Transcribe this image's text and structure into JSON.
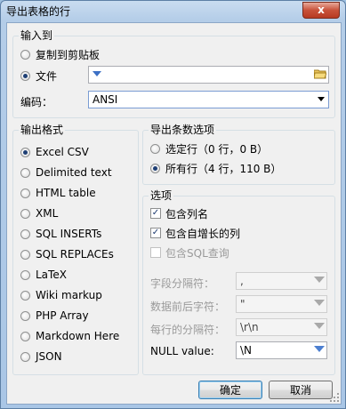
{
  "window": {
    "title": "导出表格的行",
    "close_label": "x"
  },
  "output_to": {
    "legend": "输入到",
    "clipboard_label": "复制到剪贴板",
    "file_label": "文件",
    "file_value": "",
    "encoding_label": "编码：",
    "encoding_value": "ANSI"
  },
  "format": {
    "legend": "输出格式",
    "options": [
      "Excel CSV",
      "Delimited text",
      "HTML table",
      "XML",
      "SQL INSERTs",
      "SQL REPLACEs",
      "LaTeX",
      "Wiki markup",
      "PHP Array",
      "Markdown Here",
      "JSON"
    ],
    "selected": "Excel CSV"
  },
  "row_selection": {
    "legend": "导出条数选项",
    "selected_rows": "选定行（0 行，0 B）",
    "all_rows": "所有行（4 行，110 B）",
    "selected": "all_rows"
  },
  "options": {
    "legend": "选项",
    "include_column_names": "包含列名",
    "include_auto_increment": "包含自增长的列",
    "include_sql_query": "包含SQL查询",
    "field_sep_label": "字段分隔符：",
    "field_sep_value": ",",
    "enclosure_label": "数据前后字符：",
    "enclosure_value": "\"",
    "line_sep_label": "每行的分隔符：",
    "line_sep_value": "\\r\\n",
    "null_label": "NULL value:",
    "null_value": "\\N"
  },
  "buttons": {
    "ok": "确定",
    "cancel": "取消"
  }
}
